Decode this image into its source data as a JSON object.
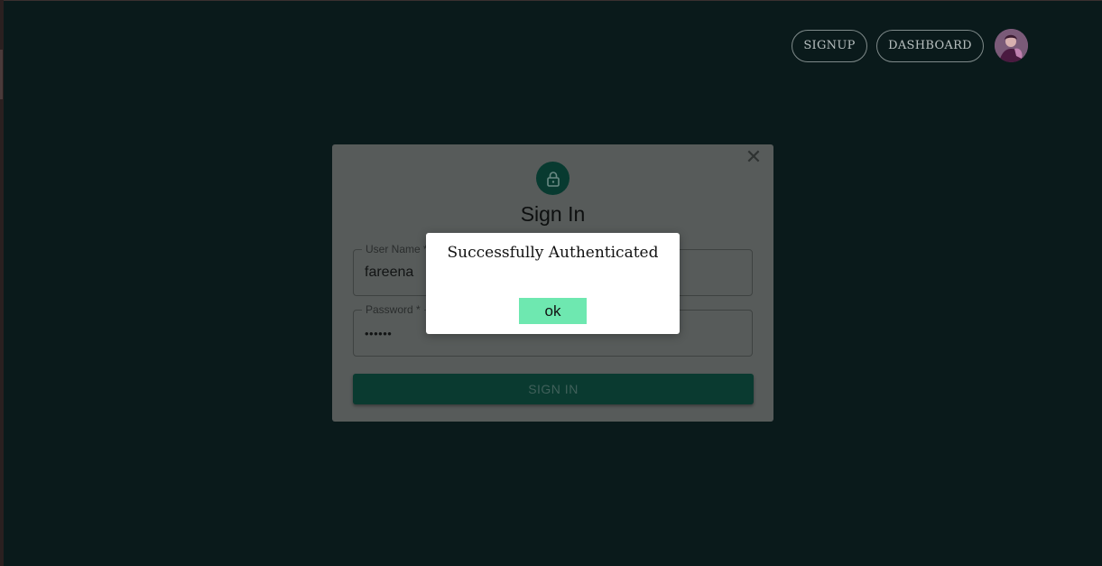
{
  "nav": {
    "signup_label": "SIGNUP",
    "dashboard_label": "DASHBOARD",
    "avatar_icon": "user-avatar-icon"
  },
  "signin": {
    "title": "Sign In",
    "lock_icon": "lock-icon",
    "close_icon": "close-icon",
    "close_glyph": "✕",
    "username": {
      "label": "User Name *",
      "value": "fareena"
    },
    "password": {
      "label": "Password *",
      "value": "••••••"
    },
    "submit_label": "SIGN IN"
  },
  "alert": {
    "message": "Successfully Authenticated",
    "ok_label": "ok"
  },
  "colors": {
    "background": "#0a1a1b",
    "accent": "#083a30",
    "ok_button": "#6ee8b0"
  }
}
